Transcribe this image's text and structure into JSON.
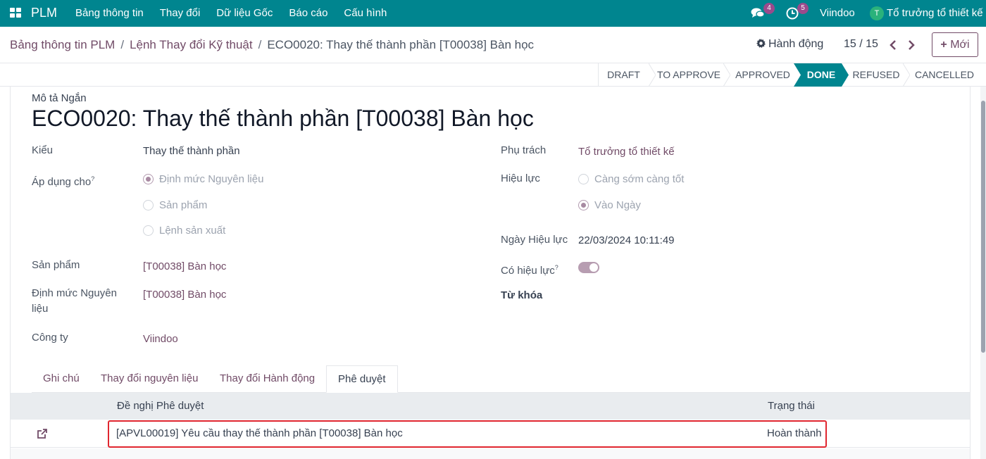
{
  "nav": {
    "brand": "PLM",
    "menu": [
      "Bảng thông tin",
      "Thay đổi",
      "Dữ liệu Gốc",
      "Báo cáo",
      "Cấu hình"
    ],
    "messages_count": "4",
    "activities_count": "5",
    "company": "Viindoo",
    "avatar_initial": "T",
    "user": "Tổ trưởng tổ thiết kế"
  },
  "breadcrumb": {
    "item1": "Bảng thông tin PLM",
    "item2": "Lệnh Thay đổi Kỹ thuật",
    "current": "ECO0020: Thay thế thành phần [T00038] Bàn học",
    "separator": "/"
  },
  "control": {
    "actions_label": "Hành động",
    "pager": "15 / 15",
    "new_label": "Mới"
  },
  "stages": [
    {
      "label": "DRAFT",
      "active": false
    },
    {
      "label": "TO APPROVE",
      "active": false
    },
    {
      "label": "APPROVED",
      "active": false
    },
    {
      "label": "DONE",
      "active": true
    },
    {
      "label": "REFUSED",
      "active": false
    },
    {
      "label": "CANCELLED",
      "active": false
    }
  ],
  "form": {
    "short_desc_label": "Mô tả Ngắn",
    "title": "ECO0020: Thay thế thành phần [T00038] Bàn học",
    "type_label": "Kiểu",
    "type_value": "Thay thế thành phần",
    "apply_on_label": "Áp dụng cho",
    "apply_on_help": "?",
    "apply_on_options": [
      "Định mức Nguyên liệu",
      "Sản phẩm",
      "Lệnh sản xuất"
    ],
    "apply_on_selected": "Định mức Nguyên liệu",
    "product_label": "Sản phẩm",
    "product_value": "[T00038] Bàn học",
    "bom_label": "Định mức Nguyên liệu",
    "bom_value": "[T00038] Bàn học",
    "company_label": "Công ty",
    "company_value": "Viindoo",
    "responsible_label": "Phụ trách",
    "responsible_value": "Tổ trưởng tổ thiết kế",
    "effectivity_label": "Hiệu lực",
    "effectivity_options": [
      "Càng sớm càng tốt",
      "Vào Ngày"
    ],
    "effectivity_selected": "Vào Ngày",
    "effective_date_label": "Ngày Hiệu lực",
    "effective_date_value": "22/03/2024 10:11:49",
    "is_effective_label": "Có hiệu lực",
    "is_effective_help": "?",
    "is_effective": true,
    "tags_label": "Từ khóa"
  },
  "tabs": [
    {
      "label": "Ghi chú",
      "active": false
    },
    {
      "label": "Thay đổi nguyên liệu",
      "active": false
    },
    {
      "label": "Thay đổi Hành động",
      "active": false
    },
    {
      "label": "Phê duyệt",
      "active": true
    }
  ],
  "approvals": {
    "columns": [
      "Đề nghị Phê duyệt",
      "Trạng thái"
    ],
    "rows": [
      {
        "request": "[APVL00019] Yêu cầu thay thế thành phần [T00038] Bàn học",
        "status": "Hoàn thành"
      }
    ]
  },
  "colors": {
    "navbar": "#00858f",
    "link": "#714b67",
    "stage_active": "#00858f",
    "highlight_border": "#e0262f"
  }
}
